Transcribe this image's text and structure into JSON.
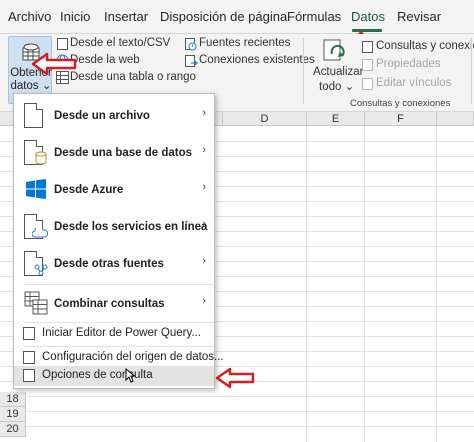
{
  "tabs": [
    "Archivo",
    "Inicio",
    "Insertar",
    "Disposición de página",
    "Fórmulas",
    "Datos",
    "Revisar"
  ],
  "ribbon": {
    "get_data_label_1": "Obtener",
    "get_data_label_2": "datos",
    "get_data_caret": "⌄",
    "from_text_csv": "Desde el texto/CSV",
    "from_web": "Desde la web",
    "from_table": "Desde una tabla o rango",
    "recent_sources": "Fuentes recientes",
    "existing_connections": "Conexiones existentes",
    "refresh_label_1": "Actualizar",
    "refresh_label_2": "todo",
    "queries_connections": "Consultas y conexiones",
    "properties": "Propiedades",
    "edit_links": "Editar vínculos",
    "group_queries": "Consultas y conexiones"
  },
  "sheet": {
    "columns": [
      "D",
      "E",
      "F"
    ],
    "rows": [
      "18",
      "19",
      "20"
    ]
  },
  "menu": {
    "items": [
      {
        "label": "Desde un archivo",
        "chevron": "›"
      },
      {
        "label": "Desde una base de datos",
        "chevron": "›"
      },
      {
        "label": "Desde Azure",
        "chevron": "›"
      },
      {
        "label": "Desde los servicios en línea",
        "chevron": "›"
      },
      {
        "label": "Desde otras fuentes",
        "chevron": "›"
      },
      {
        "label": "Combinar consultas",
        "chevron": "›"
      }
    ],
    "simple_items": [
      {
        "label": "Iniciar Editor de Power Query..."
      },
      {
        "label": "Configuración del origen de datos..."
      },
      {
        "label": "Opciones de consulta"
      }
    ]
  },
  "colors": {
    "accent_green": "#217346",
    "annotation_red": "#d31e1e",
    "azure_blue": "#0078d4"
  }
}
